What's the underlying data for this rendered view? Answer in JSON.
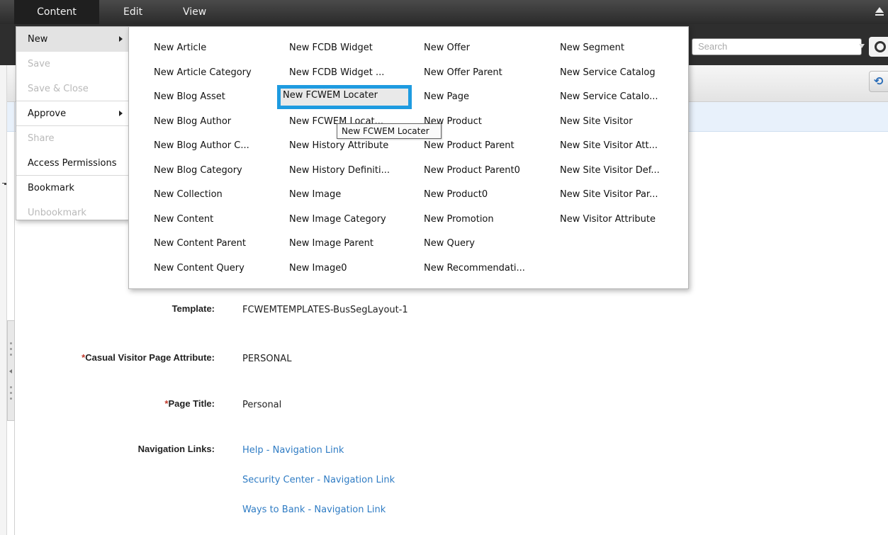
{
  "menubar": {
    "items": [
      {
        "label": "Content"
      },
      {
        "label": "Edit"
      },
      {
        "label": "View"
      }
    ]
  },
  "search": {
    "placeholder": "Search"
  },
  "content_menu": {
    "items": [
      {
        "label": "New",
        "enabled": true,
        "submenu": true
      },
      {
        "label": "Save",
        "enabled": false
      },
      {
        "label": "Save & Close",
        "enabled": false
      },
      {
        "label": "Approve",
        "enabled": true,
        "submenu": true
      },
      {
        "label": "Share",
        "enabled": false
      },
      {
        "label": "Access Permissions",
        "enabled": true
      },
      {
        "label": "Bookmark",
        "enabled": true
      },
      {
        "label": "Unbookmark",
        "enabled": false
      }
    ]
  },
  "new_submenu": {
    "columns": [
      [
        "New Article",
        "New Article Category",
        "New Blog Asset",
        "New Blog Author",
        "New Blog Author C...",
        "New Blog Category",
        "New Collection",
        "New Content",
        "New Content Parent",
        "New Content Query"
      ],
      [
        "New FCDB Widget",
        "New FCDB Widget ...",
        "New FCWEM Locater",
        "New FCWEM Locat...",
        "New History Attribute",
        "New History Definiti...",
        "New Image",
        "New Image Category",
        "New Image Parent",
        "New Image0"
      ],
      [
        "New Offer",
        "New Offer Parent",
        "New Page",
        "New Product",
        "New Product Parent",
        "New Product Parent0",
        "New Product0",
        "New Promotion",
        "New Query",
        "New Recommendati..."
      ],
      [
        "New Segment",
        "New Service Catalog",
        "New Service Catalo...",
        "New Site Visitor",
        "New Site Visitor Att...",
        "New Site Visitor Def...",
        "New Site Visitor Par...",
        "New Visitor Attribute"
      ]
    ],
    "tooltip": "New FCWEM Locater"
  },
  "form": {
    "template_label": "Template:",
    "template_value": "FCWEMTEMPLATES-BusSegLayout-1",
    "casual_label": "Casual Visitor Page Attribute:",
    "casual_value": "PERSONAL",
    "title_label": "Page Title:",
    "title_value": "Personal",
    "nav_label": "Navigation Links:",
    "nav_links": [
      "Help - Navigation Link",
      "Security Center - Navigation Link",
      "Ways to Bank - Navigation Link"
    ],
    "required_mark": "*"
  }
}
